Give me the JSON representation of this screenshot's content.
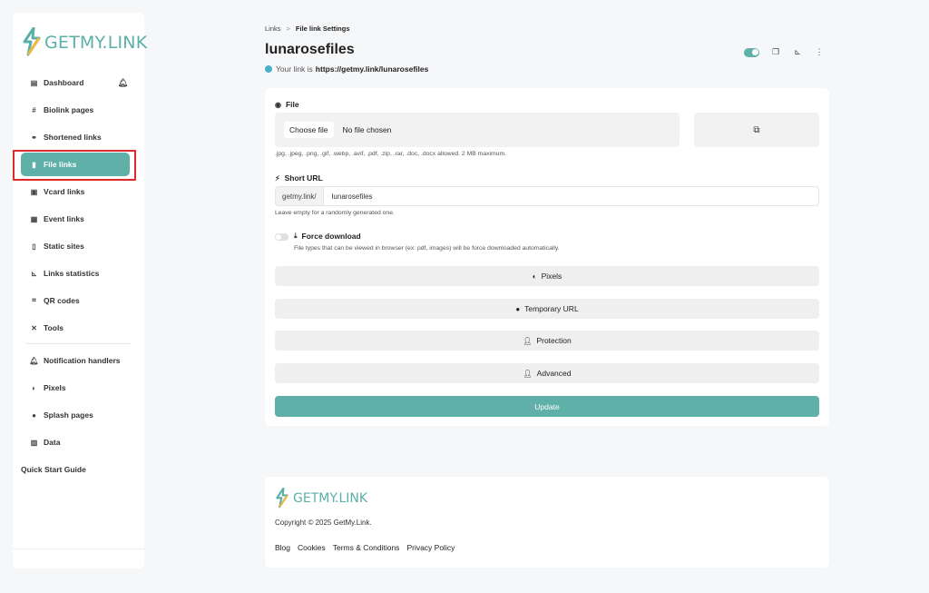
{
  "sidebar": {
    "logo_text": "GETMY.LINK",
    "items": [
      {
        "label": "Dashboard",
        "icon": "dashboard-icon"
      },
      {
        "label": "Biolink pages",
        "icon": "hash-icon"
      },
      {
        "label": "Shortened links",
        "icon": "link-icon"
      },
      {
        "label": "File links",
        "icon": "file-icon",
        "active": true
      },
      {
        "label": "Vcard links",
        "icon": "vcard-icon"
      },
      {
        "label": "Event links",
        "icon": "calendar-icon"
      },
      {
        "label": "Static sites",
        "icon": "file-code-icon"
      },
      {
        "label": "Links statistics",
        "icon": "chart-icon"
      },
      {
        "label": "QR codes",
        "icon": "qr-icon"
      },
      {
        "label": "Tools",
        "icon": "tools-icon"
      },
      {
        "label": "Notification handlers",
        "icon": "bell-icon"
      },
      {
        "label": "Pixels",
        "icon": "adjust-icon"
      },
      {
        "label": "Splash pages",
        "icon": "droplet-icon"
      },
      {
        "label": "Data",
        "icon": "database-icon"
      },
      {
        "label": "Quick Start Guide",
        "icon": ""
      }
    ]
  },
  "breadcrumb": {
    "parent": "Links",
    "separator": ">",
    "current": "File link Settings"
  },
  "page": {
    "title": "lunarosefiles",
    "your_link_label": "Your link is",
    "your_link_url": "https://getmy.link/lunarosefiles"
  },
  "form": {
    "file_label": "File",
    "choose_file": "Choose file",
    "no_file": "No file chosen",
    "file_hint": ".jpg, .jpeg, .png, .gif, .webp, .avif, .pdf, .zip, .rar, .doc, .docx allowed. 2 MB maximum.",
    "short_url_label": "Short URL",
    "url_prefix": "getmy.link/",
    "url_value": "lunarosefiles",
    "url_hint": "Leave empty for a randomly generated one.",
    "force_download_label": "Force download",
    "force_download_hint": "File types that can be viewed in browser (ex: pdf, images) will be force downloaded automatically.",
    "sections": [
      "Pixels",
      "Temporary URL",
      "Protection",
      "Advanced"
    ],
    "update_label": "Update"
  },
  "footer": {
    "logo_text": "GETMY.LINK",
    "copyright": "Copyright © 2025 GetMy.Link.",
    "links": [
      "Blog",
      "Cookies",
      "Terms & Conditions",
      "Privacy Policy"
    ]
  },
  "colors": {
    "accent": "#5fb0a8",
    "highlight": "#e0282a"
  }
}
